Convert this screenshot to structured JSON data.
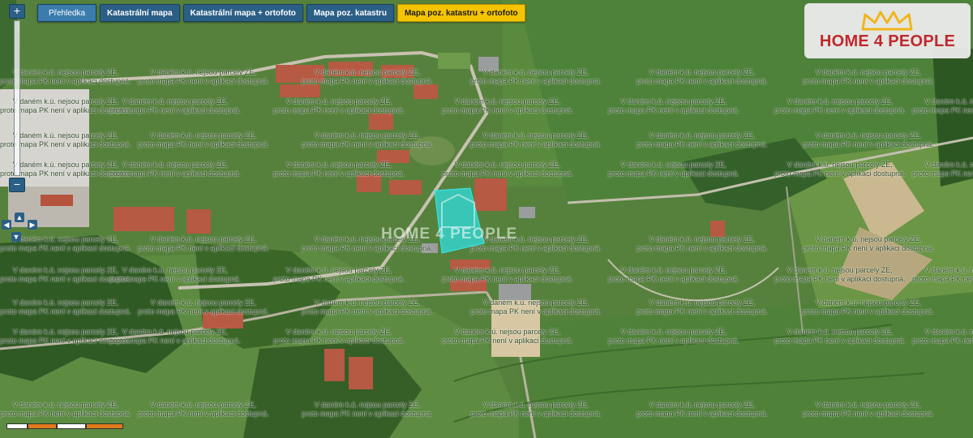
{
  "toolbar": {
    "buttons": [
      {
        "label": "Přehledka",
        "active": false
      },
      {
        "label": "Katastrální mapa",
        "active": false
      },
      {
        "label": "Katastrální mapa + ortofoto",
        "active": false
      },
      {
        "label": "Mapa poz. katastru",
        "active": false
      },
      {
        "label": "Mapa poz. katastru + ortofoto",
        "active": true
      }
    ]
  },
  "zoom": {
    "in_label": "+",
    "out_label": "−"
  },
  "logo": {
    "text": "HOME 4 PEOPLE",
    "icon": "crown-icon"
  },
  "watermark": {
    "line1": "V daném k.ú. nejsou parcely ZE,",
    "line2": "proto mapa PK není v aplikaci dostupná."
  },
  "center_watermark": "HOME 4 PEOPLE",
  "colors": {
    "active_button": "#f5c400",
    "button": "#2b5f86",
    "parcel": "#2fe0e6",
    "logo_red": "#c0282d"
  }
}
